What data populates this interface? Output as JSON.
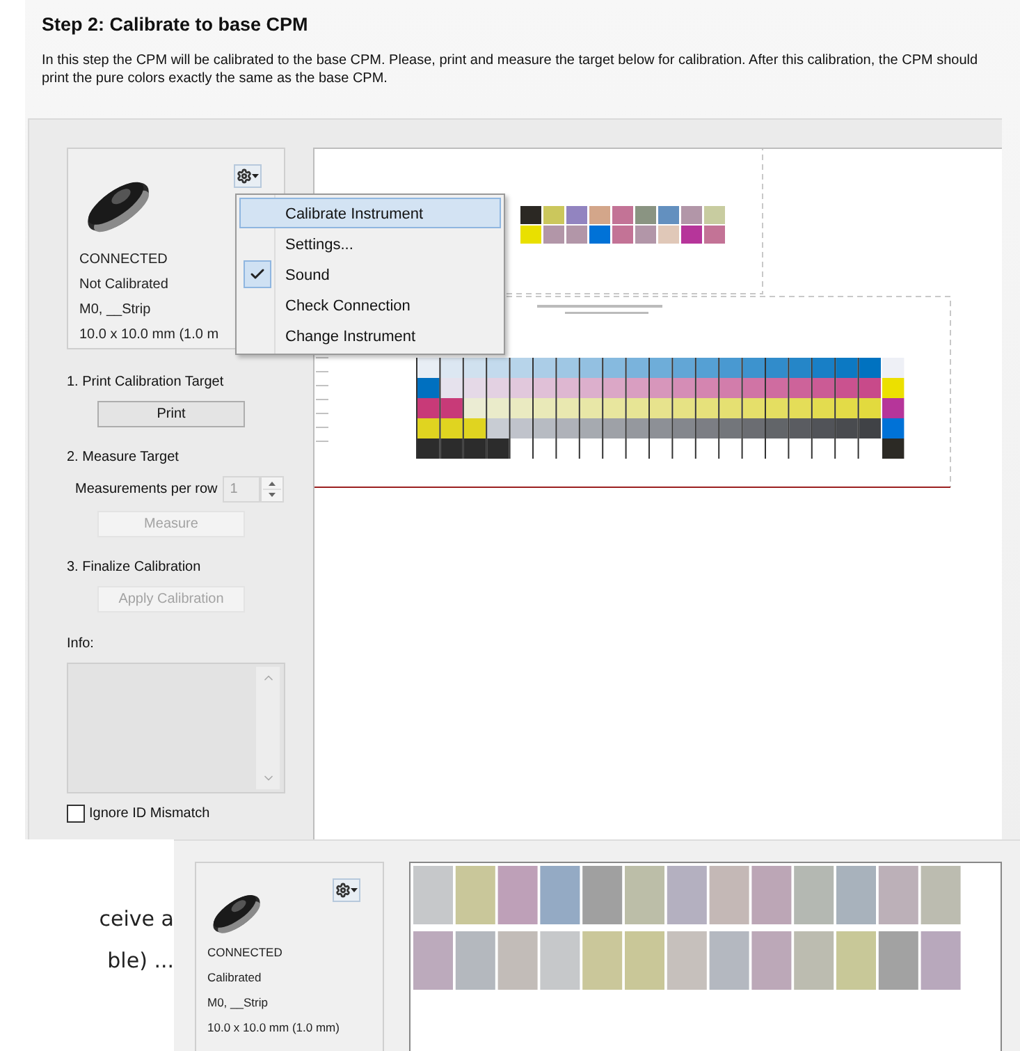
{
  "title": "Step 2: Calibrate to base CPM",
  "description": "In this step the CPM will be calibrated to the base CPM. Please, print and measure the target below for calibration. After this calibration, the CPM should print the pure colors exactly the same as the base CPM.",
  "device": {
    "status": "CONNECTED",
    "calibration": "Not Calibrated",
    "mode": "M0, __Strip",
    "aperture": "10.0 x 10.0 mm (1.0 m"
  },
  "menu": {
    "items": [
      {
        "label": "Calibrate Instrument",
        "selected": true,
        "checked": false
      },
      {
        "label": "Settings...",
        "selected": false,
        "checked": false
      },
      {
        "label": "Sound",
        "selected": false,
        "checked": true
      },
      {
        "label": "Check Connection",
        "selected": false,
        "checked": false
      },
      {
        "label": "Change Instrument",
        "selected": false,
        "checked": false
      }
    ]
  },
  "steps": [
    {
      "label": "1. Print Calibration Target",
      "button": {
        "label": "Print",
        "disabled": false
      }
    },
    {
      "label": "2. Measure Target",
      "spinner": {
        "label": "Measurements per row",
        "value": "1",
        "disabled": true
      },
      "button": {
        "label": "Measure",
        "disabled": true
      }
    },
    {
      "label": "3. Finalize Calibration",
      "button": {
        "label": "Apply Calibration",
        "disabled": true
      }
    }
  ],
  "info": {
    "label": "Info:"
  },
  "ignore_id_mismatch": {
    "label": "Ignore ID Mismatch",
    "checked": false
  },
  "background_text": [
    "ceive a",
    "ble) ..."
  ],
  "second_view": {
    "device": {
      "status": "CONNECTED",
      "calibration": "Calibrated",
      "mode": "M0, __Strip",
      "aperture": "10.0 x 10.0 mm (1.0 mm)"
    }
  }
}
